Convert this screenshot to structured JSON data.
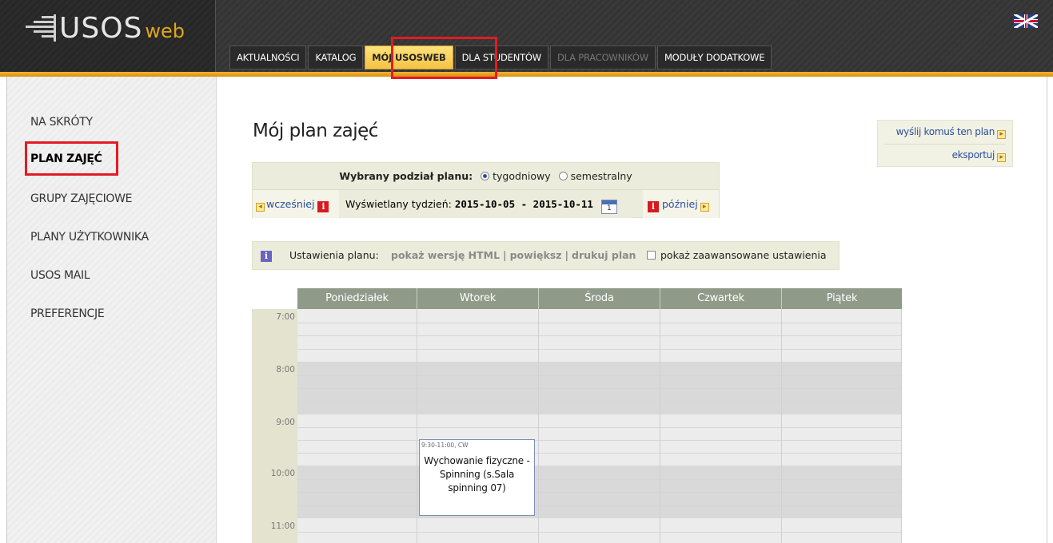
{
  "header": {
    "logo_main": "USOS",
    "logo_sub": "web",
    "language_flag": "uk-flag-icon",
    "tabs": [
      {
        "label": "AKTUALNOŚCI",
        "state": "normal"
      },
      {
        "label": "KATALOG",
        "state": "normal"
      },
      {
        "label": "MÓJ USOSWEB",
        "state": "active"
      },
      {
        "label": "DLA STUDENTÓW",
        "state": "normal"
      },
      {
        "label": "DLA PRACOWNIKÓW",
        "state": "disabled"
      },
      {
        "label": "MODUŁY DODATKOWE",
        "state": "normal"
      }
    ]
  },
  "sidebar": {
    "items": [
      {
        "label": "NA SKRÓTY"
      },
      {
        "label": "PLAN ZAJĘĆ",
        "active": true
      },
      {
        "label": "GRUPY ZAJĘCIOWE"
      },
      {
        "label": "PLANY UŻYTKOWNIKA"
      },
      {
        "label": "USOS MAIL"
      },
      {
        "label": "PREFERENCJE"
      }
    ]
  },
  "main": {
    "title": "Mój plan zajęć",
    "side_actions": {
      "send": "wyślij komuś ten plan",
      "export": "eksportuj"
    },
    "plan_division": {
      "label": "Wybrany podział planu:",
      "option_weekly": "tygodniowy",
      "option_semester": "semestralny",
      "selected": "tygodniowy"
    },
    "week_nav": {
      "earlier": "wcześniej",
      "later": "później",
      "displayed_label": "Wyświetlany tydzień:",
      "range": "2015-10-05 - 2015-10-11",
      "calendar_day": "1"
    },
    "settings": {
      "label": "Ustawienia planu:",
      "html": "pokaż wersję HTML",
      "sep1": "|",
      "enlarge": "powiększ",
      "sep2": "|",
      "print": "drukuj plan",
      "advanced": "pokaż zaawansowane ustawienia"
    },
    "timetable": {
      "days": [
        "Poniedziałek",
        "Wtorek",
        "Środa",
        "Czwartek",
        "Piątek"
      ],
      "hours": [
        "7:00",
        "8:00",
        "9:00",
        "10:00",
        "11:00"
      ],
      "event": {
        "time": "9:30-11:00, CW",
        "title": "Wychowanie fizyczne - Spinning (s.Sala spinning 07)"
      }
    }
  }
}
